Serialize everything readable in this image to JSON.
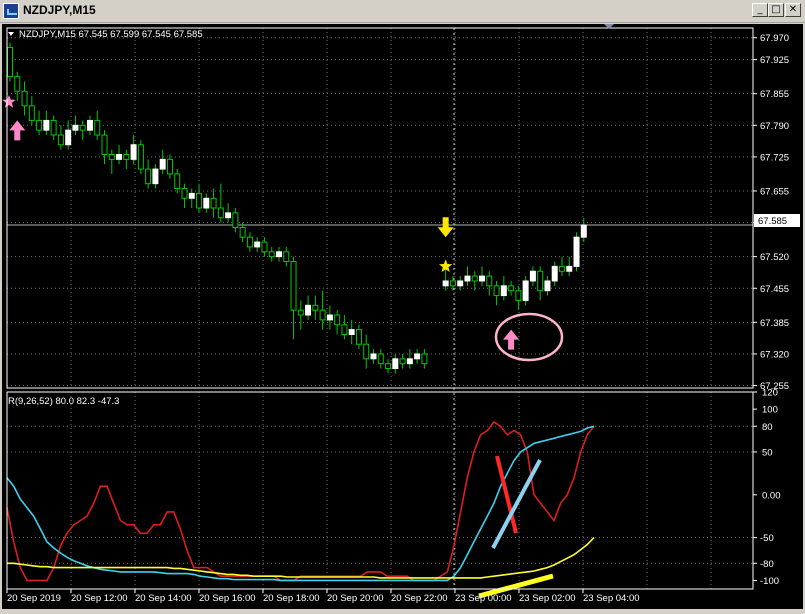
{
  "window": {
    "title": "NZDJPY,M15"
  },
  "window_buttons": {
    "minimize": "_",
    "maximize": "□",
    "close": "✕"
  },
  "chart_header": "NZDJPY,M15  67.545 67.599 67.545 67.585",
  "indicator_header": "R(9,26,52) 80.0 82.3 -47.3",
  "current_price_label": "67.585",
  "colors": {
    "background": "#000000",
    "grid": "#6e6e6e",
    "bull_candle": "#ffffff",
    "wick": "#00c800",
    "bear_candle": "#000000",
    "signal_up": "#ff8ac8",
    "signal_down": "#ffe600",
    "indicator_fast": "#dc1e1e",
    "indicator_mid": "#3cd2f0",
    "indicator_slow": "#ffff32",
    "annotation_red": "#ff2828",
    "annotation_blue": "#8cd2f0",
    "annotation_yellow": "#ffff1e",
    "annotation_circle": "#ffb4c8"
  },
  "icons": [
    "app-icon",
    "dropdown-triangle-icon",
    "up-arrow-icon",
    "down-arrow-icon",
    "star-icon"
  ],
  "chart_data": [
    {
      "type": "candlestick",
      "symbol": "NZDJPY",
      "timeframe": "M15",
      "ylim": [
        67.25,
        67.99
      ],
      "y_ticks": [
        "67.970",
        "67.925",
        "67.855",
        "67.790",
        "67.725",
        "67.655",
        "67.590",
        "67.520",
        "67.455",
        "67.385",
        "67.320",
        "67.255"
      ],
      "x_ticks": [
        "20 Sep 2019",
        "20 Sep 12:00",
        "20 Sep 14:00",
        "20 Sep 16:00",
        "20 Sep 18:00",
        "20 Sep 20:00",
        "20 Sep 22:00",
        "23 Sep 00:00",
        "23 Sep 02:00",
        "23 Sep 04:00"
      ],
      "grid": true,
      "last_price": 67.585,
      "candles": [
        [
          67.95,
          67.89,
          67.96,
          67.88
        ],
        [
          67.89,
          67.86,
          67.9,
          67.84
        ],
        [
          67.86,
          67.83,
          67.88,
          67.81
        ],
        [
          67.83,
          67.8,
          67.85,
          67.79
        ],
        [
          67.8,
          67.78,
          67.82,
          67.77
        ],
        [
          67.78,
          67.8,
          67.82,
          67.77
        ],
        [
          67.8,
          67.77,
          67.81,
          67.76
        ],
        [
          67.77,
          67.75,
          67.79,
          67.74
        ],
        [
          67.75,
          67.78,
          67.8,
          67.74
        ],
        [
          67.78,
          67.79,
          67.81,
          67.77
        ],
        [
          67.79,
          67.78,
          67.8,
          67.76
        ],
        [
          67.78,
          67.8,
          67.81,
          67.77
        ],
        [
          67.8,
          67.77,
          67.82,
          67.76
        ],
        [
          67.77,
          67.73,
          67.78,
          67.71
        ],
        [
          67.73,
          67.72,
          67.74,
          67.69
        ],
        [
          67.72,
          67.73,
          67.75,
          67.71
        ],
        [
          67.73,
          67.72,
          67.74,
          67.7
        ],
        [
          67.72,
          67.75,
          67.77,
          67.71
        ],
        [
          67.75,
          67.7,
          67.76,
          67.69
        ],
        [
          67.7,
          67.67,
          67.72,
          67.66
        ],
        [
          67.67,
          67.7,
          67.71,
          67.66
        ],
        [
          67.7,
          67.72,
          67.74,
          67.69
        ],
        [
          67.72,
          67.69,
          67.73,
          67.68
        ],
        [
          67.69,
          67.66,
          67.7,
          67.65
        ],
        [
          67.66,
          67.64,
          67.67,
          67.62
        ],
        [
          67.64,
          67.65,
          67.66,
          67.62
        ],
        [
          67.65,
          67.62,
          67.67,
          67.61
        ],
        [
          67.62,
          67.64,
          67.65,
          67.61
        ],
        [
          67.64,
          67.62,
          67.66,
          67.6
        ],
        [
          67.62,
          67.6,
          67.67,
          67.59
        ],
        [
          67.6,
          67.61,
          67.63,
          67.59
        ],
        [
          67.61,
          67.58,
          67.62,
          67.57
        ],
        [
          67.58,
          67.56,
          67.59,
          67.55
        ],
        [
          67.56,
          67.54,
          67.57,
          67.53
        ],
        [
          67.54,
          67.55,
          67.56,
          67.53
        ],
        [
          67.55,
          67.53,
          67.56,
          67.52
        ],
        [
          67.53,
          67.52,
          67.54,
          67.51
        ],
        [
          67.52,
          67.53,
          67.54,
          67.51
        ],
        [
          67.53,
          67.51,
          67.54,
          67.5
        ],
        [
          67.51,
          67.41,
          67.52,
          67.35
        ],
        [
          67.41,
          67.4,
          67.43,
          67.37
        ],
        [
          67.4,
          67.42,
          67.44,
          67.39
        ],
        [
          67.42,
          67.41,
          67.44,
          67.39
        ],
        [
          67.41,
          67.39,
          67.45,
          67.37
        ],
        [
          67.39,
          67.4,
          67.42,
          67.37
        ],
        [
          67.4,
          67.38,
          67.41,
          67.36
        ],
        [
          67.38,
          67.36,
          67.4,
          67.35
        ],
        [
          67.36,
          67.37,
          67.39,
          67.34
        ],
        [
          67.37,
          67.34,
          67.38,
          67.33
        ],
        [
          67.34,
          67.31,
          67.36,
          67.29
        ],
        [
          67.31,
          67.32,
          67.33,
          67.3
        ],
        [
          67.32,
          67.3,
          67.33,
          67.29
        ],
        [
          67.3,
          67.29,
          67.31,
          67.28
        ],
        [
          67.29,
          67.31,
          67.32,
          67.28
        ],
        [
          67.31,
          67.3,
          67.32,
          67.29
        ],
        [
          67.3,
          67.31,
          67.33,
          67.29
        ],
        [
          67.31,
          67.32,
          67.33,
          67.3
        ],
        [
          67.32,
          67.3,
          67.33,
          67.29
        ],
        [
          67.46,
          67.47,
          67.5,
          67.45
        ],
        [
          67.47,
          67.46,
          67.48,
          67.45
        ],
        [
          67.46,
          67.47,
          67.48,
          67.45
        ],
        [
          67.47,
          67.48,
          67.5,
          67.46
        ],
        [
          67.48,
          67.47,
          67.49,
          67.45
        ],
        [
          67.47,
          67.48,
          67.5,
          67.46
        ],
        [
          67.48,
          67.46,
          67.49,
          67.44
        ],
        [
          67.46,
          67.44,
          67.47,
          67.42
        ],
        [
          67.44,
          67.46,
          67.48,
          67.43
        ],
        [
          67.46,
          67.45,
          67.47,
          67.44
        ],
        [
          67.45,
          67.43,
          67.46,
          67.41
        ],
        [
          67.43,
          67.47,
          67.48,
          67.42
        ],
        [
          67.47,
          67.49,
          67.5,
          67.46
        ],
        [
          67.49,
          67.45,
          67.5,
          67.43
        ],
        [
          67.45,
          67.47,
          67.48,
          67.44
        ],
        [
          67.47,
          67.5,
          67.51,
          67.46
        ],
        [
          67.5,
          67.49,
          67.52,
          67.48
        ],
        [
          67.49,
          67.5,
          67.52,
          67.48
        ],
        [
          67.5,
          67.56,
          67.57,
          67.49
        ],
        [
          67.56,
          67.585,
          67.6,
          67.55
        ]
      ],
      "signals": [
        {
          "kind": "buy-arrow",
          "candle": 1,
          "price": 67.8
        },
        {
          "kind": "sell-arrow",
          "candle": 58,
          "price": 67.56
        },
        {
          "kind": "star",
          "candle": 58,
          "price": 67.5
        },
        {
          "kind": "buy-arrow",
          "candle": 67,
          "price": 67.37
        }
      ]
    },
    {
      "type": "line",
      "name": "R(9,26,52)",
      "ylim": [
        -110,
        120
      ],
      "y_ticks": [
        120,
        100,
        80,
        50,
        0,
        -50,
        -80,
        -100
      ],
      "reference_lines": [
        80,
        50,
        -50,
        -80
      ],
      "series": [
        {
          "color": "#dc1e1e",
          "values": [
            -15,
            -55,
            -85,
            -100,
            -100,
            -100,
            -100,
            -85,
            -60,
            -45,
            -35,
            -30,
            -25,
            -10,
            10,
            10,
            -10,
            -30,
            -35,
            -35,
            -45,
            -45,
            -35,
            -35,
            -20,
            -20,
            -40,
            -65,
            -85,
            -85,
            -85,
            -90,
            -95,
            -95,
            -95,
            -95,
            -95,
            -95,
            -95,
            -95,
            -95,
            -100,
            -100,
            -100,
            -95,
            -95,
            -95,
            -95,
            -95,
            -95,
            -95,
            -95,
            -95,
            -95,
            -90,
            -90,
            -90,
            -95,
            -95,
            -95,
            -95,
            -100,
            -100,
            -100,
            -100,
            -95,
            -90,
            -60,
            -20,
            20,
            50,
            70,
            75,
            85,
            80,
            70,
            75,
            70,
            50,
            0,
            -10,
            -20,
            -30,
            -10,
            0,
            20,
            50,
            70,
            80
          ]
        },
        {
          "color": "#3cd2f0",
          "values": [
            20,
            10,
            -5,
            -15,
            -25,
            -40,
            -55,
            -62,
            -68,
            -73,
            -77,
            -80,
            -83,
            -85,
            -87,
            -88,
            -89,
            -90,
            -90,
            -90,
            -90,
            -90,
            -90,
            -91,
            -92,
            -92,
            -92,
            -92,
            -93,
            -95,
            -96,
            -97,
            -98,
            -98,
            -99,
            -99,
            -99,
            -99,
            -99,
            -99,
            -99,
            -100,
            -100,
            -100,
            -100,
            -100,
            -100,
            -100,
            -100,
            -100,
            -100,
            -100,
            -100,
            -100,
            -100,
            -100,
            -100,
            -100,
            -100,
            -100,
            -100,
            -100,
            -100,
            -100,
            -100,
            -100,
            -100,
            -95,
            -85,
            -70,
            -55,
            -40,
            -25,
            -10,
            10,
            25,
            40,
            50,
            55,
            60,
            62,
            64,
            66,
            68,
            70,
            72,
            74,
            78,
            80
          ]
        },
        {
          "color": "#ffff32",
          "values": [
            -80,
            -80,
            -81,
            -82,
            -83,
            -84,
            -84,
            -85,
            -85,
            -85,
            -85,
            -85,
            -85,
            -85,
            -85,
            -85,
            -85,
            -85,
            -85,
            -85,
            -85,
            -85,
            -85,
            -85,
            -85,
            -86,
            -86,
            -87,
            -88,
            -89,
            -90,
            -91,
            -92,
            -93,
            -93,
            -94,
            -94,
            -95,
            -95,
            -95,
            -95,
            -95,
            -96,
            -96,
            -96,
            -96,
            -96,
            -96,
            -96,
            -96,
            -96,
            -96,
            -96,
            -96,
            -96,
            -96,
            -97,
            -97,
            -97,
            -97,
            -97,
            -97,
            -97,
            -97,
            -97,
            -97,
            -97,
            -97,
            -97,
            -97,
            -97,
            -97,
            -96,
            -95,
            -94,
            -93,
            -92,
            -91,
            -90,
            -89,
            -87,
            -85,
            -82,
            -78,
            -74,
            -70,
            -64,
            -58,
            -50
          ]
        }
      ]
    }
  ]
}
